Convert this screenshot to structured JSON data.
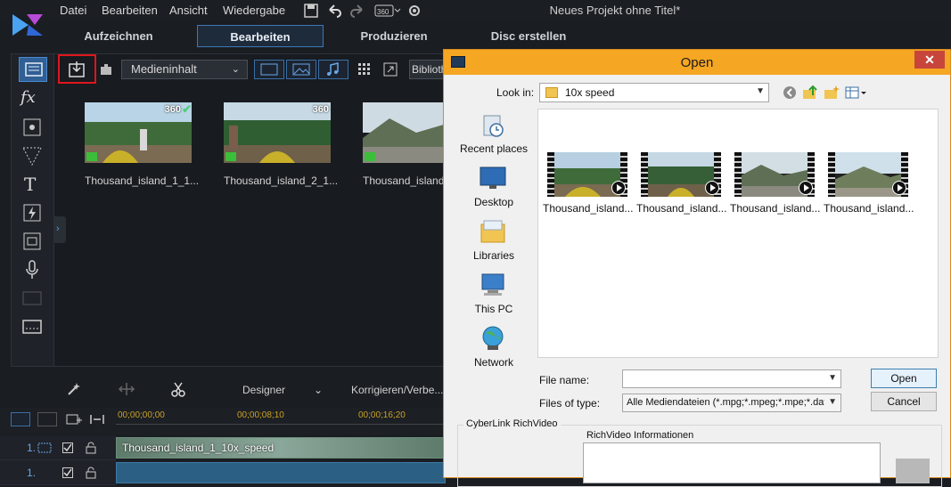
{
  "menubar": {
    "items": [
      "Datei",
      "Bearbeiten",
      "Ansicht",
      "Wiedergabe"
    ],
    "project_title": "Neues Projekt ohne Titel*"
  },
  "modes": {
    "tabs": [
      "Aufzeichnen",
      "Bearbeiten",
      "Produzieren",
      "Disc erstellen"
    ],
    "active": "Bearbeiten"
  },
  "library": {
    "content_dropdown": "Medieninhalt",
    "library_box": "Biblioth",
    "items": [
      {
        "label": "Thousand_island_1_1...",
        "badge": "360",
        "checked": true
      },
      {
        "label": "Thousand_island_2_1...",
        "badge": "360",
        "checked": false
      },
      {
        "label": "Thousand_island",
        "badge": "",
        "checked": false
      }
    ]
  },
  "bottom_toolbar": {
    "designer": "Designer",
    "correct": "Korrigieren/Verbe..."
  },
  "timeline": {
    "times": [
      "00;00;00;00",
      "00;00;08;10",
      "00;00;16;20"
    ],
    "track_number": "1.",
    "clip_label": "Thousand_island_1_10x_speed"
  },
  "dialog": {
    "title": "Open",
    "close": "✕",
    "look_in_label": "Look in:",
    "look_in_value": "10x speed",
    "places": [
      "Recent places",
      "Desktop",
      "Libraries",
      "This PC",
      "Network"
    ],
    "files": [
      "Thousand_island...",
      "Thousand_island...",
      "Thousand_island...",
      "Thousand_island..."
    ],
    "file_name_label": "File name:",
    "file_name_value": "",
    "files_of_type_label": "Files of type:",
    "files_of_type_value": "Alle Mediendateien (*.mpg;*.mpeg;*.mpe;*.dat;*",
    "open_button": "Open",
    "cancel_button": "Cancel",
    "group_title": "CyberLink RichVideo",
    "richvideo_label": "RichVideo Informationen"
  },
  "colors": {
    "accent_blue": "#3f78b5",
    "highlight_red": "#e0161b",
    "dialog_title_bar": "#f5a623",
    "close_button": "#c8453b"
  }
}
